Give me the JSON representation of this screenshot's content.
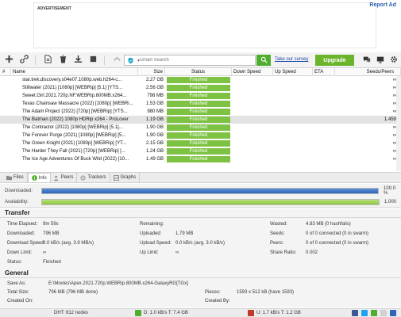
{
  "ad": {
    "label": "ADVERTISEMENT",
    "report": "Report Ad"
  },
  "search": {
    "placeholder": "Smart Search"
  },
  "toolbar": {
    "survey": "Take our survey",
    "upgrade": "Upgrade"
  },
  "list": {
    "columns": [
      "#",
      "Name",
      "Size",
      "Status",
      "Down Speed",
      "Up Speed",
      "ETA",
      "Seeds/Peers"
    ],
    "rows": [
      {
        "name": "star.trek.discovery.s04e07.1080p.web.h264-c...",
        "size": "2.27 GB",
        "status": "Finished",
        "seeds": "∞"
      },
      {
        "name": "Stillwater (2021) [1080p] [WEBRip] [5.1] [YTS...",
        "size": "2.56 GB",
        "status": "Finished",
        "seeds": "∞"
      },
      {
        "name": "Sweet.Girl.2021.720p.NF.WEBRip.800MB.x264...",
        "size": "798 MB",
        "status": "Finished",
        "seeds": "∞"
      },
      {
        "name": "Texas Chainsaw Massacre (2022) [1080p] [WEBRi...",
        "size": "1.53 GB",
        "status": "Finished",
        "seeds": "∞"
      },
      {
        "name": "The Adam Project (2022) [720p] [WEBRip] [YTS...",
        "size": "980 MB",
        "status": "Finished",
        "seeds": "∞"
      },
      {
        "name": "The Batman (2022) 1080p HDRip x264 - ProLover",
        "size": "1.19 GB",
        "status": "Finished",
        "seeds": "1.459"
      },
      {
        "name": "The Contractor (2022) [1080p] [WEBRip] [5.1]...",
        "size": "1.90 GB",
        "status": "Finished",
        "seeds": "∞"
      },
      {
        "name": "The Forever Purge (2021) [1080p] [WEBRip] [5...",
        "size": "1.90 GB",
        "status": "Finished",
        "seeds": "∞"
      },
      {
        "name": "The Green Knight (2021) [1080p] [WEBRip] [YT...",
        "size": "2.15 GB",
        "status": "Finished",
        "seeds": "∞"
      },
      {
        "name": "The Harder They Fall (2021) [720p] [WEBRip] [...",
        "size": "1.24 GB",
        "status": "Finished",
        "seeds": "∞"
      },
      {
        "name": "The Ice Age Adventures Of Buck Wild (2022) [10...",
        "size": "1.49 GB",
        "status": "Finished",
        "seeds": "∞"
      }
    ]
  },
  "tabs": [
    {
      "label": "Files"
    },
    {
      "label": "Info"
    },
    {
      "label": "Peers"
    },
    {
      "label": "Trackers"
    },
    {
      "label": "Graphs"
    }
  ],
  "progress": {
    "downloaded_label": "Downloaded:",
    "downloaded_value": "100.0 %",
    "downloaded_fraction": 1.0,
    "availability_label": "Availability:",
    "availability_value": "1.000",
    "availability_fraction": 1.0
  },
  "transfer": {
    "title": "Transfer",
    "time_elapsed_label": "Time Elapsed:",
    "time_elapsed": "9m 59s",
    "downloaded_label": "Downloaded:",
    "downloaded": "796 MB",
    "download_speed_label": "Download Speed:",
    "download_speed": "0.0 kB/s (avg. 3.9 MB/s)",
    "down_limit_label": "Down Limit:",
    "down_limit": "∞",
    "status_label": "Status:",
    "status": "Finished",
    "remaining_label": "Remaining:",
    "remaining": "",
    "uploaded_label": "Uploaded:",
    "uploaded": "1.79 MB",
    "upload_speed_label": "Upload Speed:",
    "upload_speed": "0.0 kB/s (avg. 3.0 kB/s)",
    "up_limit_label": "Up Limit:",
    "up_limit": "∞",
    "wasted_label": "Wasted:",
    "wasted": "4.83 MB (0 hashfails)",
    "seeds_label": "Seeds:",
    "seeds": "0 of 0 connected (0 in swarm)",
    "peers_label": "Peers:",
    "peers": "0 of 0 connected (0 in swarm)",
    "share_ratio_label": "Share Ratio:",
    "share_ratio": "0.002"
  },
  "general": {
    "title": "General",
    "save_as_label": "Save As:",
    "save_as": "E:\\Movies\\Apex.2021.720p.WEBRip.800MB.x264-GalaxyRG[TGx]",
    "total_size_label": "Total Size:",
    "total_size": "796 MB (796 MB done)",
    "created_on_label": "Created On:",
    "created_on": "",
    "pieces_label": "Pieces:",
    "pieces": "1593 x 512 kB (have 1593)",
    "created_by_label": "Created By:",
    "created_by": ""
  },
  "statusbar": {
    "dht": "DHT: 812 nodes",
    "down": "D: 1.0 kB/s T: 7.4 GB",
    "up": "U: 1.7 kB/s T: 1.2 GB"
  },
  "colors": {
    "finished": "#7dc242",
    "accent": "#4fae2f",
    "upgrade": "#6bb42b",
    "link": "#1a47a8"
  }
}
